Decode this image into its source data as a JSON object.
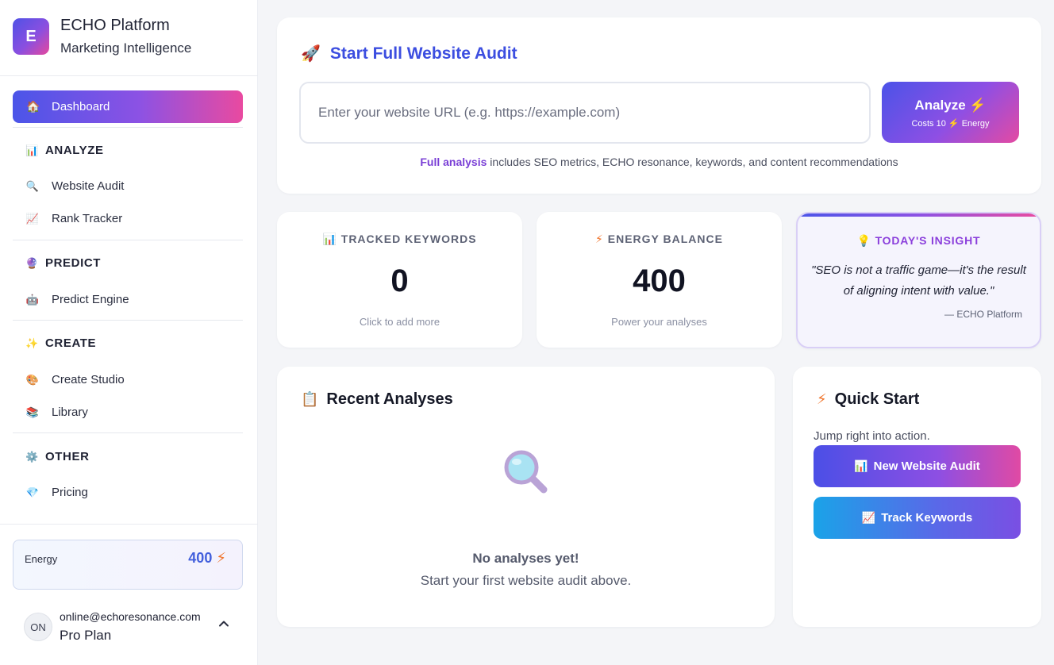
{
  "brand": {
    "logo_letter": "E",
    "name": "ECHO Platform",
    "subtitle": "Marketing Intelligence"
  },
  "nav": {
    "dashboard": {
      "label": "Dashboard",
      "icon": "house-icon"
    },
    "sections": [
      {
        "title": "ANALYZE",
        "icon": "bar-chart-icon",
        "items": [
          {
            "label": "Website Audit",
            "icon": "magnifier-icon"
          },
          {
            "label": "Rank Tracker",
            "icon": "trend-up-icon"
          }
        ]
      },
      {
        "title": "PREDICT",
        "icon": "crystal-ball-icon",
        "items": [
          {
            "label": "Predict Engine",
            "icon": "robot-icon"
          }
        ]
      },
      {
        "title": "CREATE",
        "icon": "sparkles-icon",
        "items": [
          {
            "label": "Create Studio",
            "icon": "palette-icon"
          },
          {
            "label": "Library",
            "icon": "books-icon"
          }
        ]
      },
      {
        "title": "OTHER",
        "icon": "gear-icon",
        "items": [
          {
            "label": "Pricing",
            "icon": "diamond-icon"
          }
        ]
      }
    ]
  },
  "energy": {
    "label": "Energy",
    "value": "400"
  },
  "user": {
    "initials": "ON",
    "email": "online@echoresonance.com",
    "plan": "Pro Plan"
  },
  "audit": {
    "title": "Start Full Website Audit",
    "placeholder": "Enter your website URL (e.g. https://example.com)",
    "analyze_label": "Analyze",
    "analyze_sub_prefix": "Costs 10",
    "analyze_sub_suffix": "Energy",
    "note_highlight": "Full analysis",
    "note_text": " includes SEO metrics, ECHO resonance, keywords, and content recommendations"
  },
  "stats": {
    "keywords": {
      "label": "TRACKED KEYWORDS",
      "value": "0",
      "sub": "Click to add more"
    },
    "energy": {
      "label": "ENERGY BALANCE",
      "value": "400",
      "sub": "Power your analyses"
    }
  },
  "insight": {
    "label": "TODAY'S INSIGHT",
    "quote": "\"SEO is not a traffic game—it's the result of aligning intent with value.\"",
    "author": "— ECHO Platform"
  },
  "recent": {
    "title": "Recent Analyses",
    "empty_title": "No analyses yet!",
    "empty_sub": "Start your first website audit above."
  },
  "quick": {
    "title": "Quick Start",
    "subtitle": "Jump right into action.",
    "audit_button": "New Website Audit",
    "track_button": "Track Keywords"
  },
  "colors": {
    "accent": "#4b55e8",
    "accent_pink": "#e94aa0",
    "energy": "#f0732a"
  }
}
